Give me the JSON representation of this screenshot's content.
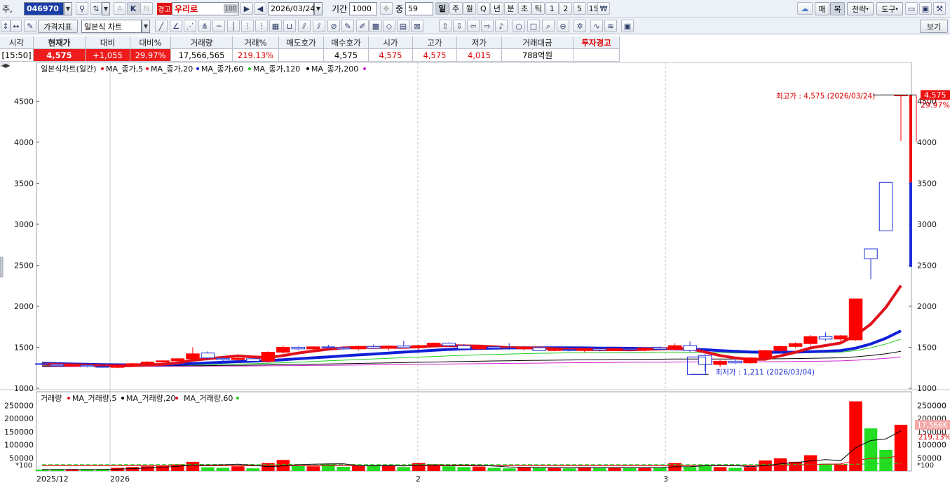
{
  "toolbar": {
    "market_label": "주,",
    "code": "046970",
    "k_label": "K",
    "a_label": "A",
    "n_label": "N",
    "warning_badge": "경고",
    "stock_name": "우리로",
    "ratio_badge": "100",
    "date": "2026/03/24",
    "period_label": "기간",
    "period_value": "1000",
    "mid_label": "중",
    "mid_value": "59",
    "periods": [
      "일",
      "주",
      "월",
      "Q",
      "년",
      "분",
      "초",
      "틱",
      "1",
      "2",
      "5",
      "15"
    ],
    "active_period": "일",
    "currency_icon": "₩",
    "right_buttons": [
      "매",
      "복",
      "전략",
      "도구"
    ],
    "price_index_label": "가격지표",
    "chart_type": "일본식 차트",
    "view_label": "보기"
  },
  "quote": {
    "headers": [
      "시각",
      "현재가",
      "대비",
      "대비%",
      "거래량",
      "거래%",
      "매도호가",
      "매수호가",
      "시가",
      "고가",
      "저가",
      "거래대금",
      "투자경고"
    ],
    "values": [
      "[15:50]",
      "4,575",
      "+1,055",
      "29.97%",
      "17,566,565",
      "219.13%",
      "",
      "4,575",
      "4,575",
      "4,575",
      "4,015",
      "788억원",
      ""
    ]
  },
  "chart": {
    "legend_title": "일본식차트(일간)",
    "ma_labels": [
      "MA_종가,5",
      "MA_종가,20",
      "MA_종가,60",
      "MA_종가,120",
      "MA_종가,200"
    ],
    "ma_colors": [
      "#e0101a",
      "#e0101a",
      "#1020d8",
      "#22cc22",
      "#000000",
      "#d020d0"
    ],
    "price_ticks": [
      "4500",
      "4000",
      "3500",
      "3000",
      "2500",
      "2000",
      "1500",
      "1000"
    ],
    "max_annotation": "최고가 : 4,575 (2026/03/24)",
    "min_annotation": "최저가 : 1,211 (2026/03/04)",
    "last_price_tag": "4,575",
    "last_change_tag": "29.97%",
    "volume_legend_title": "거래량",
    "volume_ma_labels": [
      "MA_거래량,5",
      "MA_거래량,20",
      "MA_거래량,60"
    ],
    "volume_ticks": [
      "250000",
      "200000",
      "150000",
      "100000",
      "50000"
    ],
    "volume_unit": "*100",
    "volume_tag": "17,566K",
    "volume_pct_tag": "219.13%",
    "date_labels": [
      "2025/12",
      "2026",
      "2",
      "3"
    ],
    "up_color": "#ff0000",
    "down_color": "#1f2fd8",
    "volume_up_color": "#ff0000",
    "volume_down_color": "#22dd22"
  },
  "chart_data": {
    "type": "candlestick",
    "title": "일본식차트(일간)",
    "ylim": [
      1000,
      4700
    ],
    "volume_ylim": [
      0,
      280000
    ],
    "candles": [
      {
        "o": 1300,
        "h": 1310,
        "l": 1280,
        "c": 1290,
        "v": 5000
      },
      {
        "o": 1290,
        "h": 1300,
        "l": 1265,
        "c": 1275,
        "v": 6000
      },
      {
        "o": 1275,
        "h": 1290,
        "l": 1260,
        "c": 1280,
        "v": 5500
      },
      {
        "o": 1280,
        "h": 1295,
        "l": 1255,
        "c": 1265,
        "v": 5000
      },
      {
        "o": 1265,
        "h": 1285,
        "l": 1250,
        "c": 1260,
        "v": 6500
      },
      {
        "o": 1255,
        "h": 1290,
        "l": 1245,
        "c": 1285,
        "v": 12000
      },
      {
        "o": 1285,
        "h": 1310,
        "l": 1270,
        "c": 1300,
        "v": 15000
      },
      {
        "o": 1300,
        "h": 1330,
        "l": 1290,
        "c": 1320,
        "v": 18000
      },
      {
        "o": 1320,
        "h": 1340,
        "l": 1305,
        "c": 1335,
        "v": 20000
      },
      {
        "o": 1335,
        "h": 1370,
        "l": 1325,
        "c": 1360,
        "v": 25000
      },
      {
        "o": 1360,
        "h": 1500,
        "l": 1340,
        "c": 1420,
        "v": 35000
      },
      {
        "o": 1430,
        "h": 1450,
        "l": 1340,
        "c": 1370,
        "v": 14000
      },
      {
        "o": 1365,
        "h": 1385,
        "l": 1330,
        "c": 1350,
        "v": 12000
      },
      {
        "o": 1350,
        "h": 1380,
        "l": 1330,
        "c": 1365,
        "v": 18000
      },
      {
        "o": 1360,
        "h": 1365,
        "l": 1320,
        "c": 1330,
        "v": 10000
      },
      {
        "o": 1330,
        "h": 1450,
        "l": 1310,
        "c": 1440,
        "v": 30000
      },
      {
        "o": 1440,
        "h": 1520,
        "l": 1420,
        "c": 1500,
        "v": 42000
      },
      {
        "o": 1500,
        "h": 1510,
        "l": 1470,
        "c": 1480,
        "v": 20000
      },
      {
        "o": 1480,
        "h": 1515,
        "l": 1460,
        "c": 1505,
        "v": 18000
      },
      {
        "o": 1505,
        "h": 1530,
        "l": 1485,
        "c": 1495,
        "v": 25000
      },
      {
        "o": 1495,
        "h": 1510,
        "l": 1470,
        "c": 1480,
        "v": 16000
      },
      {
        "o": 1480,
        "h": 1520,
        "l": 1460,
        "c": 1510,
        "v": 20000
      },
      {
        "o": 1510,
        "h": 1535,
        "l": 1480,
        "c": 1490,
        "v": 22000
      },
      {
        "o": 1490,
        "h": 1520,
        "l": 1460,
        "c": 1515,
        "v": 22000
      },
      {
        "o": 1515,
        "h": 1580,
        "l": 1490,
        "c": 1495,
        "v": 15000
      },
      {
        "o": 1495,
        "h": 1530,
        "l": 1470,
        "c": 1520,
        "v": 30000
      },
      {
        "o": 1520,
        "h": 1560,
        "l": 1500,
        "c": 1550,
        "v": 25000
      },
      {
        "o": 1550,
        "h": 1560,
        "l": 1510,
        "c": 1520,
        "v": 18000
      },
      {
        "o": 1520,
        "h": 1540,
        "l": 1470,
        "c": 1480,
        "v": 15000
      },
      {
        "o": 1480,
        "h": 1510,
        "l": 1470,
        "c": 1505,
        "v": 17000
      },
      {
        "o": 1505,
        "h": 1515,
        "l": 1480,
        "c": 1490,
        "v": 12000
      },
      {
        "o": 1490,
        "h": 1550,
        "l": 1470,
        "c": 1485,
        "v": 10000
      },
      {
        "o": 1485,
        "h": 1500,
        "l": 1460,
        "c": 1495,
        "v": 14000
      },
      {
        "o": 1495,
        "h": 1510,
        "l": 1455,
        "c": 1460,
        "v": 12000
      },
      {
        "o": 1460,
        "h": 1480,
        "l": 1450,
        "c": 1470,
        "v": 13000
      },
      {
        "o": 1470,
        "h": 1490,
        "l": 1450,
        "c": 1460,
        "v": 10000
      },
      {
        "o": 1460,
        "h": 1490,
        "l": 1440,
        "c": 1480,
        "v": 14000
      },
      {
        "o": 1480,
        "h": 1500,
        "l": 1450,
        "c": 1465,
        "v": 12000
      },
      {
        "o": 1465,
        "h": 1490,
        "l": 1455,
        "c": 1480,
        "v": 13000
      },
      {
        "o": 1480,
        "h": 1500,
        "l": 1460,
        "c": 1470,
        "v": 11000
      },
      {
        "o": 1470,
        "h": 1500,
        "l": 1450,
        "c": 1490,
        "v": 12000
      },
      {
        "o": 1490,
        "h": 1510,
        "l": 1465,
        "c": 1475,
        "v": 13000
      },
      {
        "o": 1475,
        "h": 1550,
        "l": 1460,
        "c": 1520,
        "v": 30000
      },
      {
        "o": 1520,
        "h": 1570,
        "l": 1440,
        "c": 1460,
        "v": 15000
      },
      {
        "o": 1400,
        "h": 1420,
        "l": 1211,
        "c": 1290,
        "v": 22000
      },
      {
        "o": 1290,
        "h": 1340,
        "l": 1260,
        "c": 1330,
        "v": 15000
      },
      {
        "o": 1330,
        "h": 1360,
        "l": 1300,
        "c": 1310,
        "v": 12000
      },
      {
        "o": 1310,
        "h": 1380,
        "l": 1300,
        "c": 1370,
        "v": 15000
      },
      {
        "o": 1370,
        "h": 1470,
        "l": 1360,
        "c": 1460,
        "v": 40000
      },
      {
        "o": 1460,
        "h": 1520,
        "l": 1440,
        "c": 1510,
        "v": 48000
      },
      {
        "o": 1510,
        "h": 1560,
        "l": 1490,
        "c": 1545,
        "v": 35000
      },
      {
        "o": 1545,
        "h": 1650,
        "l": 1520,
        "c": 1630,
        "v": 60000
      },
      {
        "o": 1630,
        "h": 1680,
        "l": 1580,
        "c": 1600,
        "v": 28000
      },
      {
        "o": 1600,
        "h": 1650,
        "l": 1570,
        "c": 1640,
        "v": 25000
      },
      {
        "o": 1590,
        "h": 2090,
        "l": 1580,
        "c": 2090,
        "v": 265000
      },
      {
        "o": 2700,
        "h": 2700,
        "l": 2330,
        "c": 2580,
        "v": 162000
      },
      {
        "o": 3510,
        "h": 3510,
        "l": 2920,
        "c": 2920,
        "v": 80000
      },
      {
        "o": 4575,
        "h": 4575,
        "l": 4015,
        "c": 4575,
        "v": 175666
      }
    ],
    "ma5": [
      1295,
      1290,
      1285,
      1282,
      1276,
      1273,
      1276,
      1284,
      1293,
      1310,
      1342,
      1360,
      1377,
      1395,
      1383,
      1374,
      1398,
      1430,
      1454,
      1476,
      1492,
      1498,
      1497,
      1500,
      1499,
      1505,
      1516,
      1520,
      1517,
      1515,
      1507,
      1496,
      1492,
      1491,
      1481,
      1473,
      1473,
      1471,
      1471,
      1469,
      1474,
      1479,
      1487,
      1483,
      1442,
      1399,
      1370,
      1353,
      1354,
      1396,
      1438,
      1492,
      1521,
      1552,
      1646,
      1782,
      1985,
      2252
    ],
    "ma20": [
      1305,
      1300,
      1296,
      1292,
      1289,
      1286,
      1285,
      1286,
      1289,
      1294,
      1302,
      1310,
      1317,
      1325,
      1330,
      1337,
      1349,
      1360,
      1372,
      1383,
      1396,
      1407,
      1418,
      1429,
      1441,
      1452,
      1463,
      1473,
      1481,
      1486,
      1489,
      1492,
      1493,
      1494,
      1494,
      1493,
      1492,
      1490,
      1489,
      1487,
      1485,
      1484,
      1482,
      1478,
      1470,
      1460,
      1451,
      1443,
      1438,
      1440,
      1441,
      1446,
      1452,
      1460,
      1490,
      1540,
      1610,
      1700
    ],
    "ma60": [
      1280,
      1280,
      1279,
      1279,
      1278,
      1278,
      1278,
      1279,
      1280,
      1282,
      1285,
      1288,
      1292,
      1296,
      1300,
      1305,
      1312,
      1319,
      1327,
      1335,
      1343,
      1350,
      1358,
      1365,
      1373,
      1380,
      1388,
      1395,
      1402,
      1408,
      1413,
      1418,
      1422,
      1426,
      1429,
      1432,
      1434,
      1436,
      1438,
      1439,
      1440,
      1441,
      1441,
      1440,
      1437,
      1434,
      1431,
      1429,
      1428,
      1429,
      1431,
      1434,
      1437,
      1440,
      1460,
      1495,
      1540,
      1600
    ],
    "ma120": [
      1270,
      1270,
      1271,
      1271,
      1272,
      1272,
      1273,
      1273,
      1274,
      1275,
      1276,
      1277,
      1279,
      1281,
      1283,
      1285,
      1288,
      1291,
      1294,
      1297,
      1300,
      1303,
      1307,
      1310,
      1314,
      1317,
      1320,
      1324,
      1327,
      1330,
      1333,
      1336,
      1338,
      1341,
      1343,
      1345,
      1347,
      1349,
      1351,
      1352,
      1354,
      1355,
      1356,
      1356,
      1356,
      1356,
      1356,
      1357,
      1358,
      1360,
      1362,
      1365,
      1368,
      1372,
      1384,
      1400,
      1420,
      1450
    ],
    "ma200": [
      1265,
      1265,
      1265,
      1266,
      1266,
      1266,
      1267,
      1267,
      1268,
      1268,
      1269,
      1270,
      1271,
      1272,
      1273,
      1274,
      1276,
      1277,
      1279,
      1280,
      1282,
      1284,
      1286,
      1288,
      1290,
      1292,
      1294,
      1296,
      1298,
      1300,
      1302,
      1304,
      1306,
      1307,
      1309,
      1311,
      1312,
      1314,
      1315,
      1317,
      1318,
      1319,
      1320,
      1321,
      1321,
      1322,
      1322,
      1323,
      1324,
      1325,
      1327,
      1329,
      1331,
      1334,
      1342,
      1352,
      1365,
      1382
    ],
    "vol_ma5": [
      5500,
      5600,
      5600,
      5600,
      5800,
      7000,
      9000,
      11500,
      14000,
      18000,
      22600,
      22400,
      23800,
      25800,
      21800,
      16800,
      19200,
      24400,
      26000,
      27000,
      27400,
      20800,
      19800,
      20200,
      19200,
      21600,
      23000,
      22000,
      22600,
      21200,
      19000,
      15400,
      13600,
      12800,
      12200,
      11800,
      12200,
      12000,
      12600,
      12400,
      12200,
      12400,
      16200,
      16600,
      20000,
      21000,
      21000,
      16600,
      20800,
      27400,
      32000,
      38000,
      43200,
      39200,
      88600,
      116000,
      122000,
      152733
    ],
    "vol_ma20": [
      20000,
      20000,
      20000,
      20000,
      20000,
      20000,
      20000,
      20000,
      20000,
      20000,
      20000,
      20000,
      20000,
      20000,
      20000,
      20000,
      20000,
      20000,
      20000,
      20000,
      20000,
      20000,
      20000,
      20000,
      20000,
      20000,
      20000,
      20000,
      20000,
      20000,
      20000,
      20000,
      20000,
      20000,
      20000,
      20000,
      20000,
      20000,
      20000,
      20000,
      20000,
      20000,
      20000,
      20000,
      20000,
      20000,
      20000,
      20000,
      20000,
      20000,
      22000,
      24000,
      26000,
      27000,
      40000,
      48000,
      50000,
      58000
    ],
    "vol_ma60": [
      25000,
      25000,
      25000,
      25000,
      25000,
      25000,
      25000,
      25000,
      25000,
      25000,
      25000,
      25000,
      25000,
      25000,
      25000,
      25000,
      25000,
      25000,
      25000,
      25000,
      25000,
      25000,
      25000,
      25000,
      25000,
      25000,
      25000,
      25000,
      25000,
      25000,
      25000,
      25000,
      25000,
      25000,
      25000,
      25000,
      25000,
      25000,
      25000,
      25000,
      25000,
      25000,
      25000,
      25000,
      25000,
      25000,
      25000,
      25000,
      25000,
      25000,
      25000,
      25000,
      25000,
      25000,
      26000,
      27000,
      28000,
      29000
    ]
  }
}
